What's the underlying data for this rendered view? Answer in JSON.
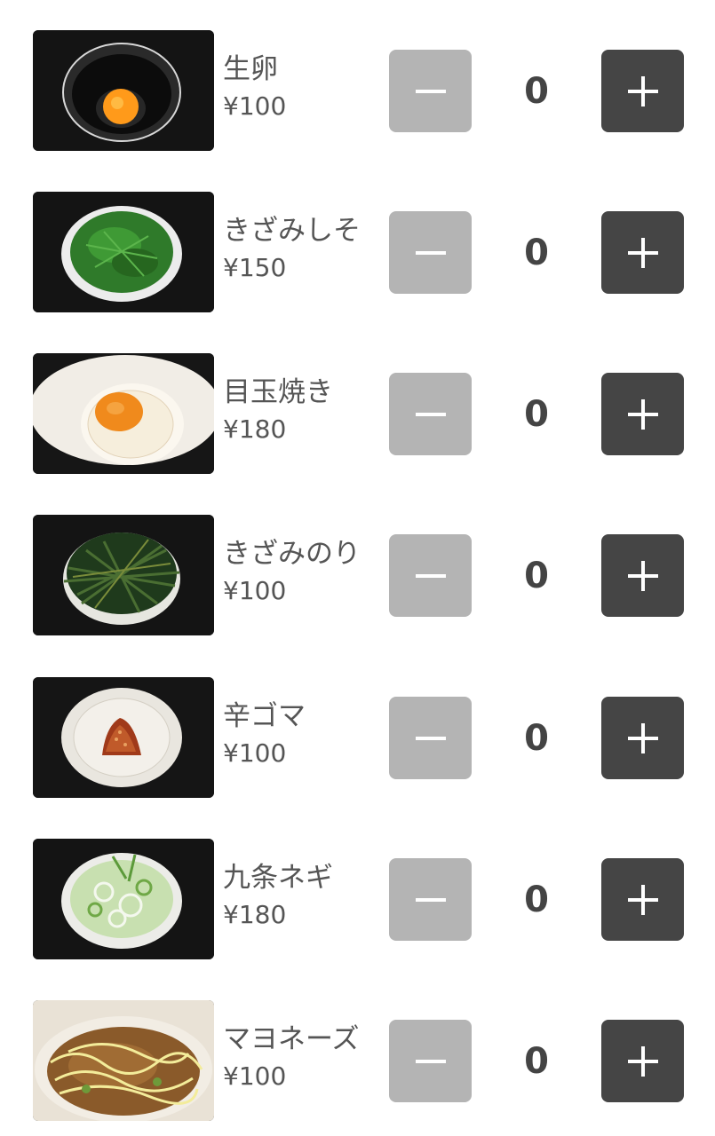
{
  "items": [
    {
      "name": "生卵",
      "price": "¥100",
      "quantity": "0",
      "image": "raw-egg-in-bowl-photo"
    },
    {
      "name": "きざみしそ",
      "price": "¥150",
      "quantity": "0",
      "image": "chopped-shiso-plate-photo"
    },
    {
      "name": "目玉焼き",
      "price": "¥180",
      "quantity": "0",
      "image": "fried-egg-plate-photo"
    },
    {
      "name": "きざみのり",
      "price": "¥100",
      "quantity": "0",
      "image": "shredded-nori-plate-photo"
    },
    {
      "name": "辛ゴマ",
      "price": "¥100",
      "quantity": "0",
      "image": "spicy-sesame-plate-photo"
    },
    {
      "name": "九条ネギ",
      "price": "¥180",
      "quantity": "0",
      "image": "kujo-green-onion-plate-photo"
    },
    {
      "name": "マヨネーズ",
      "price": "¥100",
      "quantity": "0",
      "image": "mayonnaise-dish-photo"
    }
  ],
  "icons": {
    "decrement": "minus-icon",
    "increment": "plus-icon"
  },
  "colors": {
    "minus_button": "#b4b4b4",
    "plus_button": "#454545",
    "thumb_background": "#151515"
  }
}
